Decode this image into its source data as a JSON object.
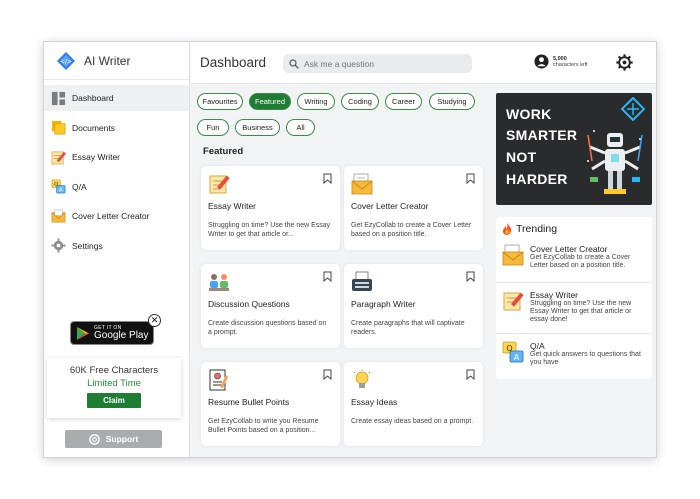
{
  "app": {
    "name": "AI Writer"
  },
  "sidebar": {
    "items": [
      {
        "label": "Dashboard",
        "icon": "dashboard-icon"
      },
      {
        "label": "Documents",
        "icon": "documents-icon"
      },
      {
        "label": "Essay Writer",
        "icon": "essay-icon"
      },
      {
        "label": "Q/A",
        "icon": "qa-icon"
      },
      {
        "label": "Cover Letter Creator",
        "icon": "envelope-icon"
      },
      {
        "label": "Settings",
        "icon": "gear-icon"
      }
    ],
    "google_play": {
      "line1": "GET IT ON",
      "line2": "Google Play",
      "close": "✕"
    },
    "promo": {
      "line1": "60K Free Characters",
      "line2": "Limited Time",
      "claim": "Claim"
    },
    "support": "Support"
  },
  "header": {
    "title": "Dashboard",
    "search_placeholder": "Ask me a question",
    "credits_value": "5,000",
    "credits_label": "characters left"
  },
  "filters": [
    "Favourites",
    "Featured",
    "Writing",
    "Coding",
    "Career",
    "Studying",
    "Fun",
    "Business",
    "All"
  ],
  "active_filter": "Featured",
  "featured_heading": "Featured",
  "cards": [
    {
      "title": "Essay Writer",
      "desc": "Struggling on time? Use the new Essay Writer to get that article or...",
      "icon": "essay-icon"
    },
    {
      "title": "Cover Letter Creator",
      "desc": "Get EzyCollab to create a Cover Letter based on a position title.",
      "icon": "envelope-icon"
    },
    {
      "title": "Discussion Questions",
      "desc": "Create discussion questions based on a prompt.",
      "icon": "discussion-icon"
    },
    {
      "title": "Paragraph Writer",
      "desc": "Create paragraphs that will captivate readers.",
      "icon": "typewriter-icon"
    },
    {
      "title": "Resume Bullet Points",
      "desc": "Get EzyCollab to write you Resume Bullet Points based on a position...",
      "icon": "resume-icon"
    },
    {
      "title": "Essay Ideas",
      "desc": "Create essay ideas based on a prompt.",
      "icon": "lightbulb-icon"
    }
  ],
  "banner": {
    "line1": "WORK",
    "line2": "SMARTER",
    "line3": "NOT",
    "line4": "HARDER"
  },
  "trending": {
    "heading": "Trending",
    "items": [
      {
        "title": "Cover Letter Creator",
        "desc": "Get EzyCollab to create a Cover Letter based on a position title.",
        "icon": "envelope-icon"
      },
      {
        "title": "Essay Writer",
        "desc": "Struggling on time? Use the new Essay Writer to get that article or essay done!",
        "icon": "essay-icon"
      },
      {
        "title": "Q/A",
        "desc": "Get quick answers to questions that you have",
        "icon": "qa-icon"
      }
    ]
  },
  "colors": {
    "accent": "#1e7d32",
    "chip_border": "#3b8a46",
    "brand_blue": "#2f80ed",
    "banner_bg": "#2a2b2c"
  }
}
